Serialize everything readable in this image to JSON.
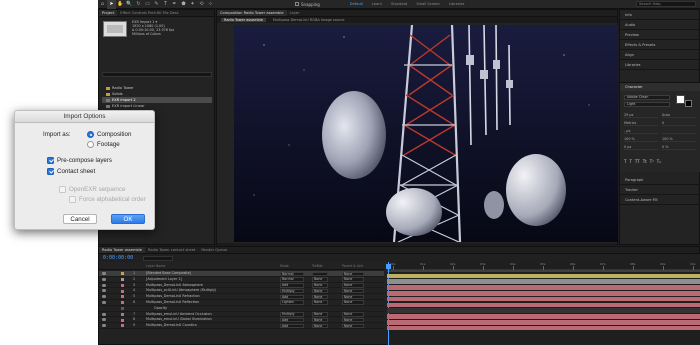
{
  "toolbar": {
    "tools": [
      "⌂",
      "➤",
      "✋",
      "🔍",
      "↻",
      "▭",
      "✎",
      "T",
      "✒",
      "⬟",
      "✦",
      "⟲",
      "⊹"
    ],
    "snapping_label": "Snapping",
    "workspaces": [
      "Default",
      "Learn",
      "Standard",
      "Small Screen",
      "Libraries"
    ],
    "search_placeholder": "Search Help"
  },
  "project_panel": {
    "tabs": [
      "Project",
      "Effect Controls Pre4.6K File Desc"
    ],
    "item_name": "EXR Import 1 ▾",
    "item_info": [
      "1920 x 1080 (1.00)",
      "Δ 0:00:10:00, 23.976 fps",
      "Millions of Colors"
    ],
    "items": [
      {
        "label": "Radio Tower",
        "folder": true,
        "selected": false
      },
      {
        "label": "Solids",
        "folder": true,
        "selected": false
      },
      {
        "label": "EXR import 2",
        "folder": false,
        "selected": true
      },
      {
        "label": "EXR import Linear",
        "folder": false,
        "selected": false
      },
      {
        "label": "EXR import Linear",
        "folder": false,
        "selected": false
      }
    ]
  },
  "comp_panel": {
    "tabs": [
      "Composition Radio Tower assemble",
      "Layer"
    ],
    "subtabs": [
      "Radio Tower assemble",
      "Multipass DemoLinU RGBA Image source"
    ],
    "zoom": "(100%)",
    "timecode": "0:00:00:00",
    "resolution": "Full",
    "camera": "Active Camera",
    "views": "1 View",
    "exposure": "+0.0"
  },
  "right_panel": {
    "items": [
      "Info",
      "Audio",
      "Preview",
      "Effects & Presets",
      "Align",
      "Libraries"
    ],
    "character_label": "Character",
    "font": "Adobe Clean",
    "style": "Light",
    "size_rows": [
      [
        "29 px",
        "Auto"
      ],
      [
        "Metrics",
        "0"
      ],
      [
        "- px",
        ""
      ],
      [
        "100 %",
        "100 %"
      ],
      [
        "0 px",
        "0 %"
      ]
    ],
    "text_buttons": [
      "T",
      "T",
      "TT",
      "Tt",
      "T¹",
      "T₁"
    ],
    "lower_items": [
      "Paragraph",
      "Tracker",
      "Content-Aware Fill"
    ]
  },
  "timeline": {
    "tabs": [
      "Radio Tower assemble",
      "Radio Tower contact sheet",
      "Render Queue"
    ],
    "timecode": "0:00:00:00",
    "columns": {
      "name": "Layer Name",
      "mode": "Mode",
      "trkmat": "TrkMat",
      "parent": "Parent & Link"
    },
    "layers": [
      {
        "num": "1",
        "name": "[Blended Base Composite]",
        "mode": "Normal",
        "trkmat": "",
        "parent": "None",
        "color": "#c4a44b",
        "selected": true
      },
      {
        "num": "2",
        "name": "[Adjustment Layer 1]",
        "mode": "Normal",
        "trkmat": "None",
        "parent": "None",
        "color": "#9e9e9e",
        "selected": false
      },
      {
        "num": "3",
        "name": "Multipass_DemoLinU Atmosphere",
        "mode": "Add",
        "trkmat": "None",
        "parent": "None",
        "color": "#c0707c",
        "selected": false
      },
      {
        "num": "4",
        "name": "Multipass_acULinU Atmosphere (Multiply)",
        "mode": "Multiply",
        "trkmat": "None",
        "parent": "None",
        "color": "#c0707c",
        "selected": false
      },
      {
        "num": "5",
        "name": "Multipass_DemoLinU Refraction",
        "mode": "Add",
        "trkmat": "None",
        "parent": "None",
        "color": "#c0707c",
        "selected": false
      },
      {
        "num": "6",
        "name": "Multipass_DemoLinU Reflection",
        "mode": "Lighten",
        "trkmat": "None",
        "parent": "None",
        "color": "#c0707c",
        "selected": false
      },
      {
        "num": "",
        "name": "Opacity",
        "mode": "",
        "trkmat": "",
        "parent": "",
        "color": "#5b5b5b",
        "selected": false
      },
      {
        "num": "7",
        "name": "Multipass_emuLinU Ambient Occlusion",
        "mode": "Multiply",
        "trkmat": "None",
        "parent": "None",
        "color": "#c0707c",
        "selected": false
      },
      {
        "num": "8",
        "name": "Multipass_emuLinU Global Illumination",
        "mode": "Add",
        "trkmat": "None",
        "parent": "None",
        "color": "#c0707c",
        "selected": false
      },
      {
        "num": "9",
        "name": "Multipass_DemoLinU Caustics",
        "mode": "Add",
        "trkmat": "None",
        "parent": "None",
        "color": "#c0707c",
        "selected": false
      }
    ],
    "ruler_labels": [
      "00s",
      "01s",
      "02s",
      "03s",
      "04s",
      "05s",
      "06s",
      "07s",
      "08s",
      "09s",
      "10s"
    ],
    "bar_colors": [
      "#bdb061",
      "#8f8f8f",
      "#b96a74",
      "#b96a74",
      "#b96a74",
      "#b96a74",
      "#333333",
      "#b96a74",
      "#b96a74",
      "#b96a74"
    ]
  },
  "dialog": {
    "title": "Import Options",
    "import_as_label": "Import as:",
    "composition_label": "Composition",
    "footage_label": "Footage",
    "precompose_label": "Pre-compose layers",
    "contact_sheet_label": "Contact sheet",
    "openexr_label": "OpenEXR sequence",
    "force_alpha_label": "Force alphabetical order",
    "cancel_label": "Cancel",
    "ok_label": "OK",
    "accent": "#2d76d8"
  }
}
